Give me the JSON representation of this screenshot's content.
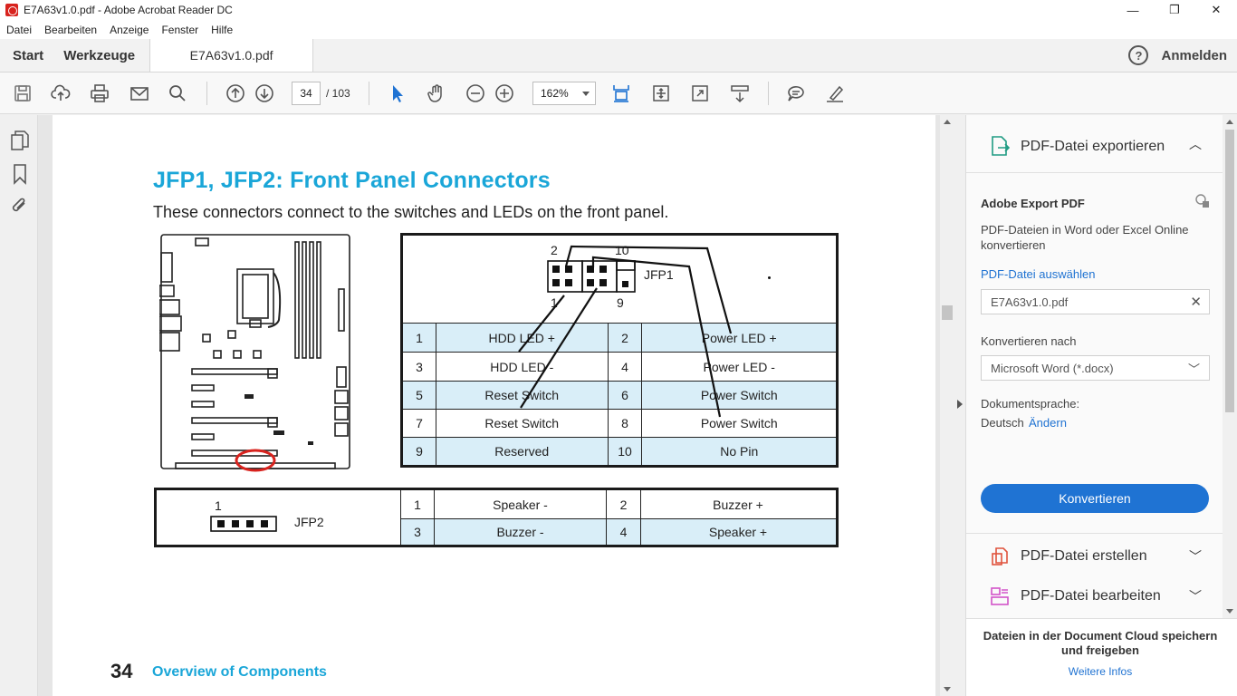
{
  "window": {
    "title": "E7A63v1.0.pdf - Adobe Acrobat Reader DC"
  },
  "menu": [
    "Datei",
    "Bearbeiten",
    "Anzeige",
    "Fenster",
    "Hilfe"
  ],
  "tabs": {
    "start": "Start",
    "tools": "Werkzeuge",
    "document": "E7A63v1.0.pdf"
  },
  "account": {
    "login": "Anmelden",
    "help": "?"
  },
  "toolbar": {
    "page_current": "34",
    "page_total": "/  103",
    "zoom": "162%"
  },
  "document": {
    "heading": "JFP1, JFP2: Front Panel Connectors",
    "subtitle": "These connectors connect to the switches and LEDs on the front panel.",
    "jfp1": {
      "label": "JFP1",
      "pin_labels": {
        "top_left": "2",
        "top_right": "10",
        "bottom_left": "1",
        "bottom_right": "9"
      },
      "rows": [
        {
          "pin1": "1",
          "name1": "HDD LED +",
          "pin2": "2",
          "name2": "Power LED +"
        },
        {
          "pin1": "3",
          "name1": "HDD LED -",
          "pin2": "4",
          "name2": "Power LED -"
        },
        {
          "pin1": "5",
          "name1": "Reset Switch",
          "pin2": "6",
          "name2": "Power Switch"
        },
        {
          "pin1": "7",
          "name1": "Reset Switch",
          "pin2": "8",
          "name2": "Power Switch"
        },
        {
          "pin1": "9",
          "name1": "Reserved",
          "pin2": "10",
          "name2": "No Pin"
        }
      ]
    },
    "jfp2": {
      "label": "JFP2",
      "pin_label": "1",
      "rows": [
        {
          "pin1": "1",
          "name1": "Speaker -",
          "pin2": "2",
          "name2": "Buzzer +"
        },
        {
          "pin1": "3",
          "name1": "Buzzer -",
          "pin2": "4",
          "name2": "Speaker +"
        }
      ]
    },
    "page_number": "34",
    "footer": "Overview of Components"
  },
  "right_panel": {
    "export_title": "PDF-Datei exportieren",
    "adobe_export": "Adobe Export PDF",
    "description": "PDF-Dateien in Word oder Excel Online konvertieren",
    "select_file": "PDF-Datei auswählen",
    "file_name": "E7A63v1.0.pdf",
    "convert_to_label": "Konvertieren nach",
    "convert_to_value": "Microsoft Word (*.docx)",
    "language_label": "Dokumentsprache:",
    "language_value": "Deutsch",
    "change": "Ändern",
    "convert_button": "Konvertieren",
    "create_pdf": "PDF-Datei erstellen",
    "edit_pdf": "PDF-Datei bearbeiten",
    "cloud_text": "Dateien in der Document Cloud speichern und freigeben",
    "more_info": "Weitere Infos"
  },
  "colors": {
    "accent": "#1aa6d8",
    "button": "#1f73d3",
    "table_highlight": "#d9eef8",
    "annotation_circle": "#d8231e"
  }
}
